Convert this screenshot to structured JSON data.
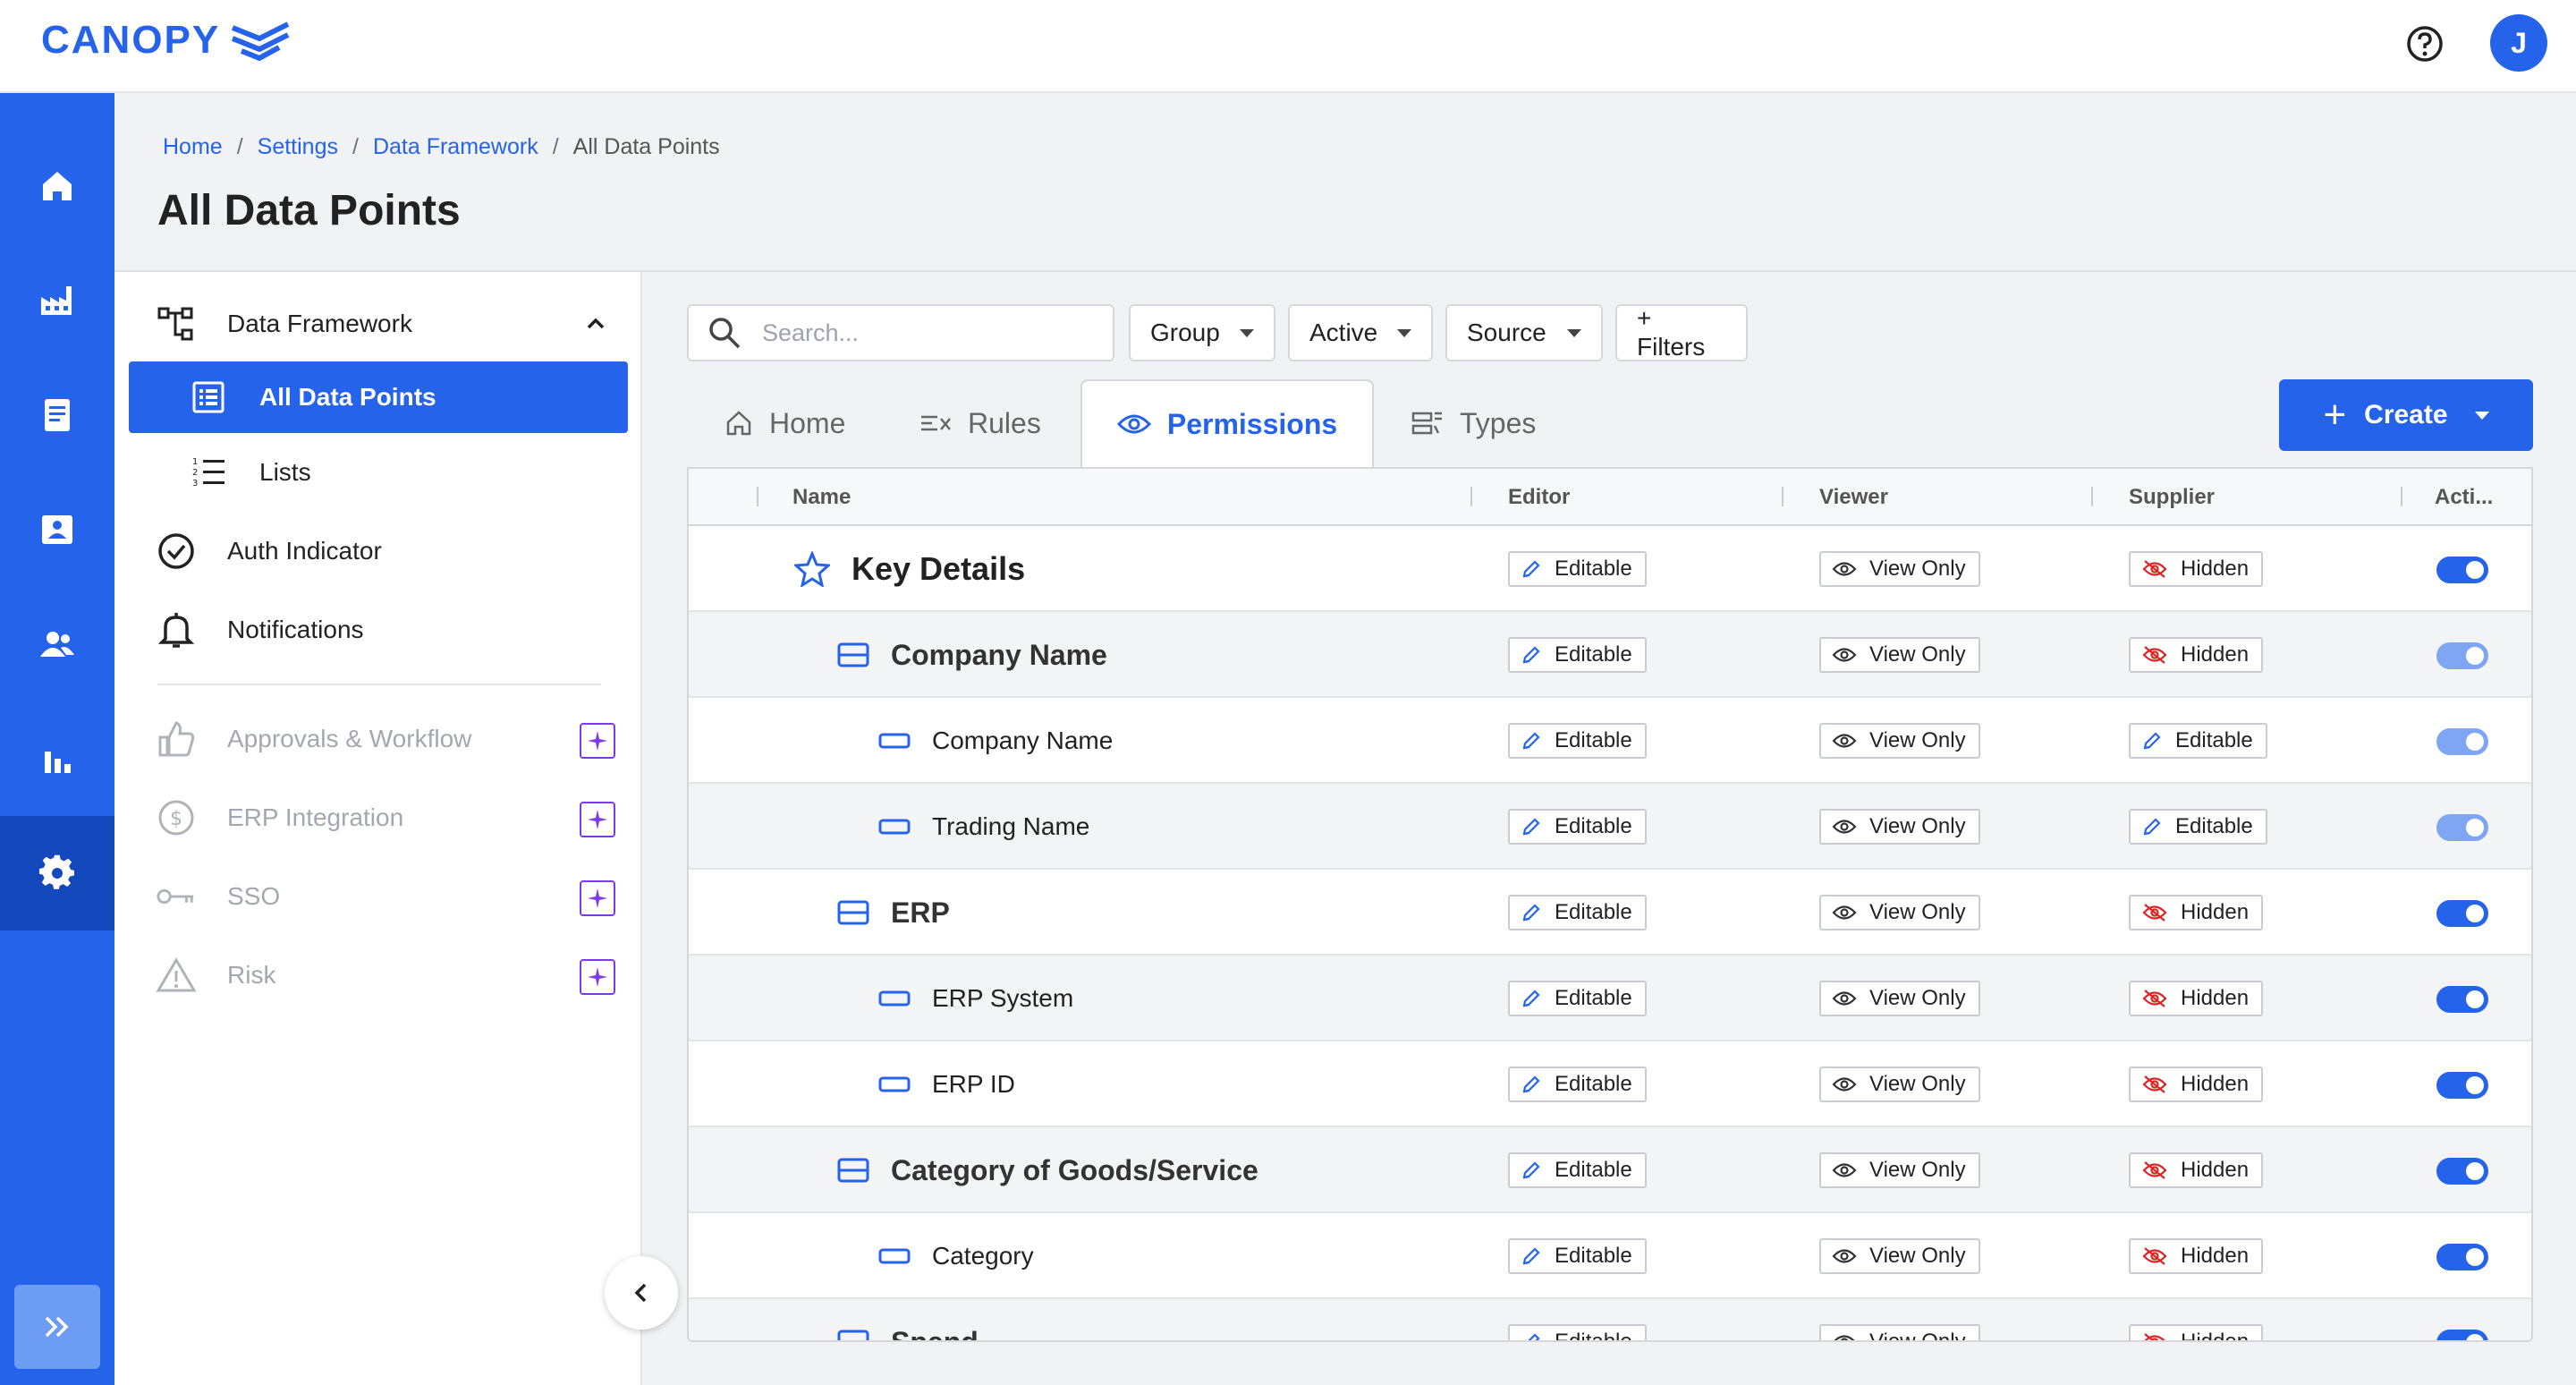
{
  "app": {
    "logo_text": "CANOPY",
    "avatar_initial": "J"
  },
  "rail": {
    "icons": [
      "home-icon",
      "factory-icon",
      "document-icon",
      "contact-card-icon",
      "users-icon",
      "bar-chart-icon",
      "gear-icon"
    ],
    "expand_icon": "double-chevron-right-icon"
  },
  "breadcrumb": {
    "items": [
      "Home",
      "Settings",
      "Data Framework"
    ],
    "current": "All Data Points",
    "separator": "/"
  },
  "page": {
    "title": "All Data Points"
  },
  "subnav": {
    "items": [
      {
        "label": "Data Framework",
        "icon": "hierarchy-icon"
      },
      {
        "label": "All Data Points",
        "icon": "list-box-icon"
      },
      {
        "label": "Lists",
        "icon": "numbered-list-icon"
      },
      {
        "label": "Auth Indicator",
        "icon": "check-circle-icon"
      },
      {
        "label": "Notifications",
        "icon": "bell-icon"
      },
      {
        "label": "Approvals & Workflow",
        "icon": "thumbs-up-icon"
      },
      {
        "label": "ERP Integration",
        "icon": "dollar-circle-icon"
      },
      {
        "label": "SSO",
        "icon": "key-icon"
      },
      {
        "label": "Risk",
        "icon": "warning-icon"
      }
    ]
  },
  "filters": {
    "search_placeholder": "Search...",
    "group_label": "Group",
    "active_label": "Active",
    "source_label": "Source",
    "more_filters_label": "+ Filters"
  },
  "tabs": [
    {
      "label": "Home",
      "icon": "home-outline-icon"
    },
    {
      "label": "Rules",
      "icon": "rules-icon"
    },
    {
      "label": "Permissions",
      "icon": "eye-icon"
    },
    {
      "label": "Types",
      "icon": "types-icon"
    }
  ],
  "create_label": "Create",
  "table": {
    "columns": [
      "Name",
      "Editor",
      "Viewer",
      "Supplier",
      "Acti..."
    ],
    "rows": [
      {
        "name": "Key Details",
        "level": 0,
        "editor": "Editable",
        "viewer": "View Only",
        "supplier": "Hidden",
        "active": true
      },
      {
        "name": "Company Name",
        "level": 1,
        "editor": "Editable",
        "viewer": "View Only",
        "supplier": "Hidden",
        "active": true
      },
      {
        "name": "Company Name",
        "level": 2,
        "editor": "Editable",
        "viewer": "View Only",
        "supplier": "Editable",
        "active": true
      },
      {
        "name": "Trading Name",
        "level": 2,
        "editor": "Editable",
        "viewer": "View Only",
        "supplier": "Editable",
        "active": true
      },
      {
        "name": "ERP",
        "level": 1,
        "editor": "Editable",
        "viewer": "View Only",
        "supplier": "Hidden",
        "active": true
      },
      {
        "name": "ERP System",
        "level": 2,
        "editor": "Editable",
        "viewer": "View Only",
        "supplier": "Hidden",
        "active": true
      },
      {
        "name": "ERP ID",
        "level": 2,
        "editor": "Editable",
        "viewer": "View Only",
        "supplier": "Hidden",
        "active": true
      },
      {
        "name": "Category of Goods/Service",
        "level": 1,
        "editor": "Editable",
        "viewer": "View Only",
        "supplier": "Hidden",
        "active": true
      },
      {
        "name": "Category",
        "level": 2,
        "editor": "Editable",
        "viewer": "View Only",
        "supplier": "Hidden",
        "active": true
      },
      {
        "name": "Spend",
        "level": 1,
        "editor": "Editable",
        "viewer": "View Only",
        "supplier": "Hidden",
        "active": true
      }
    ]
  },
  "colors": {
    "brand": "#2563eb",
    "rail_active": "#1448bd",
    "ai_badge": "#7c3aed",
    "hidden_icon": "#dc2626"
  }
}
